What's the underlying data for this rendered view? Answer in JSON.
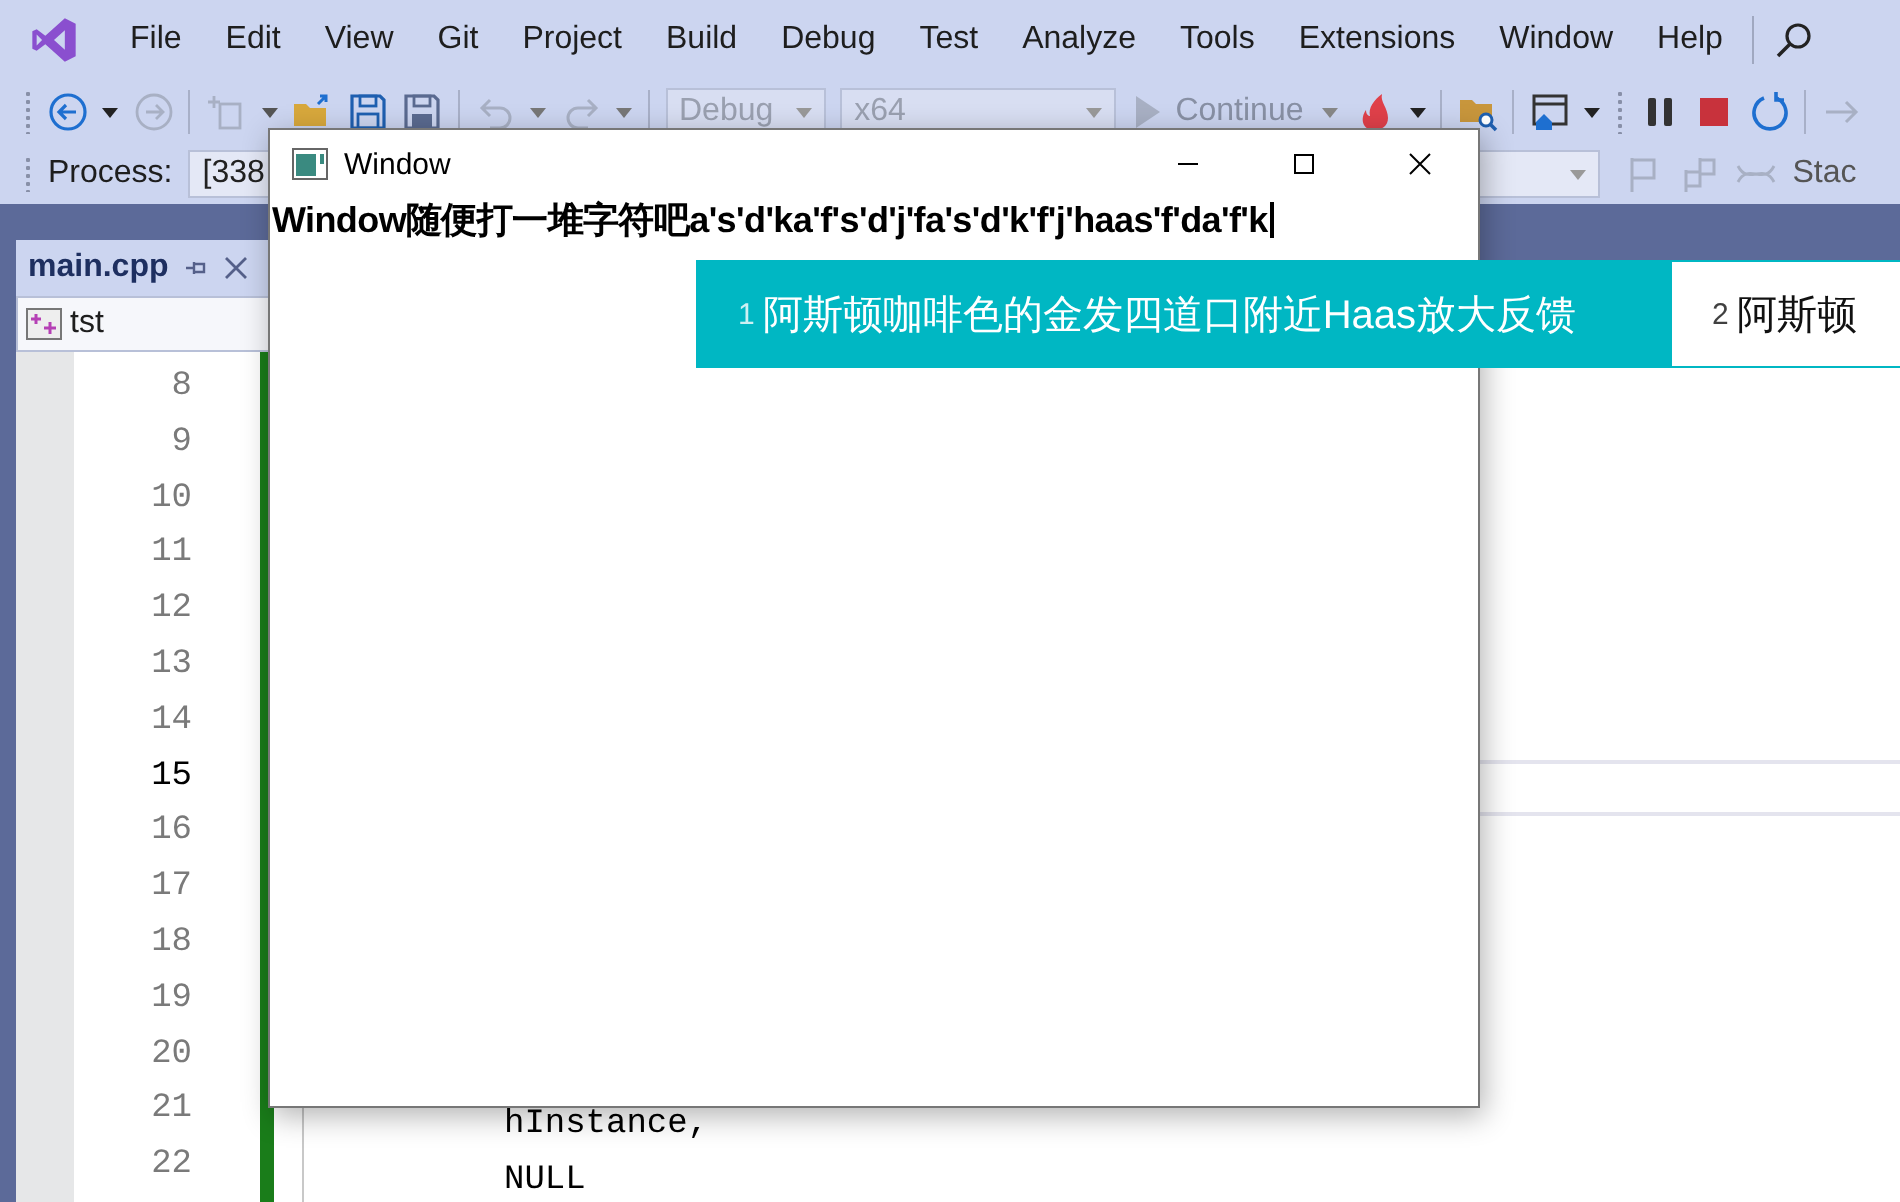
{
  "menu": [
    {
      "label": "File"
    },
    {
      "label": "Edit"
    },
    {
      "label": "View"
    },
    {
      "label": "Git"
    },
    {
      "label": "Project"
    },
    {
      "label": "Build"
    },
    {
      "label": "Debug"
    },
    {
      "label": "Test"
    },
    {
      "label": "Analyze"
    },
    {
      "label": "Tools"
    },
    {
      "label": "Extensions"
    },
    {
      "label": "Window"
    },
    {
      "label": "Help"
    }
  ],
  "toolbar": {
    "configuration": {
      "value": "Debug",
      "disabled": true
    },
    "platform": {
      "value": "x64",
      "disabled": true
    },
    "continue": {
      "label": "Continue",
      "disabled": true
    }
  },
  "debug_location": {
    "process_label": "Process:",
    "process_value": "[338",
    "stack_label": "Stac"
  },
  "document_tab": {
    "title": "main.cpp"
  },
  "nav_bar": {
    "scope": "tst"
  },
  "editor": {
    "lines": [
      {
        "number": "8",
        "current": false
      },
      {
        "number": "9",
        "current": false
      },
      {
        "number": "10",
        "current": false
      },
      {
        "number": "11",
        "current": false
      },
      {
        "number": "12",
        "current": false
      },
      {
        "number": "13",
        "current": false
      },
      {
        "number": "14",
        "current": false
      },
      {
        "number": "15",
        "current": true
      },
      {
        "number": "16",
        "current": false
      },
      {
        "number": "17",
        "current": false
      },
      {
        "number": "18",
        "current": false
      },
      {
        "number": "19",
        "current": false
      },
      {
        "number": "20",
        "current": false
      },
      {
        "number": "21",
        "current": false,
        "code": "hInstance,"
      },
      {
        "number": "22",
        "current": false,
        "code": "NULL"
      }
    ]
  },
  "app_window": {
    "title": "Window",
    "text": "Window随便打一堆字符吧a's'd'ka'f's'd'j'fa's'd'k'f'j'haas'f'da'f'k"
  },
  "ime": {
    "candidates": [
      {
        "index": "1",
        "text": "阿斯顿咖啡色的金发四道口附近Haas放大反馈",
        "selected": true
      },
      {
        "index": "2",
        "text": "阿斯顿",
        "selected": false
      }
    ]
  }
}
